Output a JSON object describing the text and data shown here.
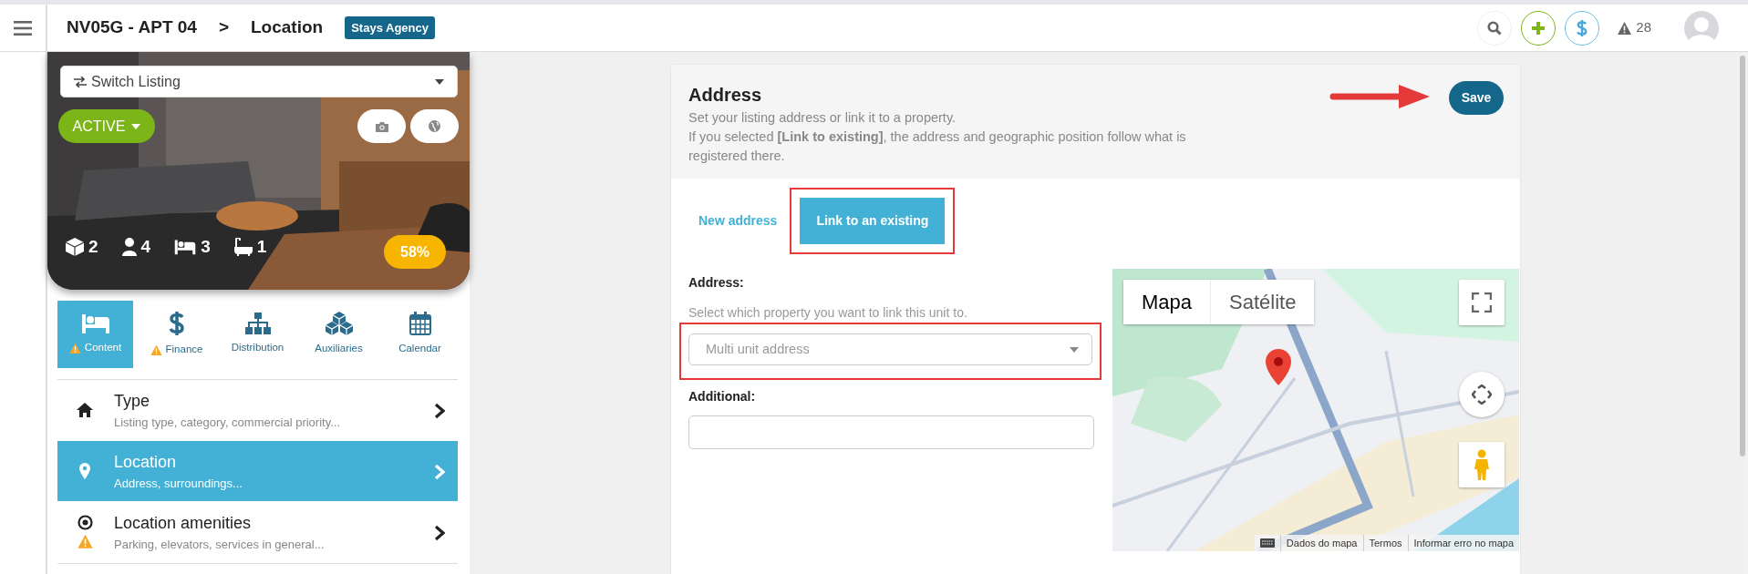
{
  "topbar": {
    "breadcrumb": [
      "NV05G - APT 04",
      "Location"
    ],
    "separator": ">",
    "badge": "Stays Agency",
    "alerts": "28"
  },
  "listing": {
    "switch_label": "Switch Listing",
    "status": "ACTIVE",
    "stats": [
      {
        "kind": "rooms",
        "value": "2"
      },
      {
        "kind": "guests",
        "value": "4"
      },
      {
        "kind": "beds",
        "value": "3"
      },
      {
        "kind": "baths",
        "value": "1"
      }
    ],
    "completion": "58%"
  },
  "section_tabs": [
    {
      "kind": "bed",
      "label": "Content",
      "selected": true,
      "warning": true
    },
    {
      "kind": "dollar",
      "label": "Finance",
      "selected": false,
      "warning": true
    },
    {
      "kind": "sitemap",
      "label": "Distribution",
      "selected": false,
      "warning": false
    },
    {
      "kind": "cubes",
      "label": "Auxiliaries",
      "selected": false,
      "warning": false
    },
    {
      "kind": "calendar",
      "label": "Calendar",
      "selected": false,
      "warning": false
    }
  ],
  "menu": [
    {
      "kind": "home",
      "title": "Type",
      "subtitle": "Listing type, category, commercial priority...",
      "selected": false,
      "warning": false
    },
    {
      "kind": "pin",
      "title": "Location",
      "subtitle": "Address, surroundings...",
      "selected": true,
      "warning": false
    },
    {
      "kind": "target",
      "title": "Location amenities",
      "subtitle": "Parking, elevators, services in general...",
      "selected": false,
      "warning": true
    }
  ],
  "address": {
    "title": "Address",
    "description": [
      "Set your listing address or link it to a property.",
      "If you selected **[Link to existing]**, the address and geographic position follow what is registered there."
    ],
    "save": {
      "label": "Save",
      "pointed_at": true
    },
    "modes": [
      {
        "label": "New address",
        "selected": false,
        "highlighted": false
      },
      {
        "label": "Link to an existing",
        "selected": true,
        "highlighted": true
      }
    ],
    "address_label": "Address:",
    "hint": "Select which property you want to link this unit to.",
    "select": {
      "placeholder": "Multi unit address",
      "highlighted": true
    },
    "additional_label": "Additional:"
  },
  "map": {
    "types": [
      {
        "label": "Mapa",
        "selected": true
      },
      {
        "label": "Satélite",
        "selected": false
      }
    ],
    "footer": [
      "Dados do mapa",
      "Termos",
      "Informar erro no mapa"
    ]
  }
}
